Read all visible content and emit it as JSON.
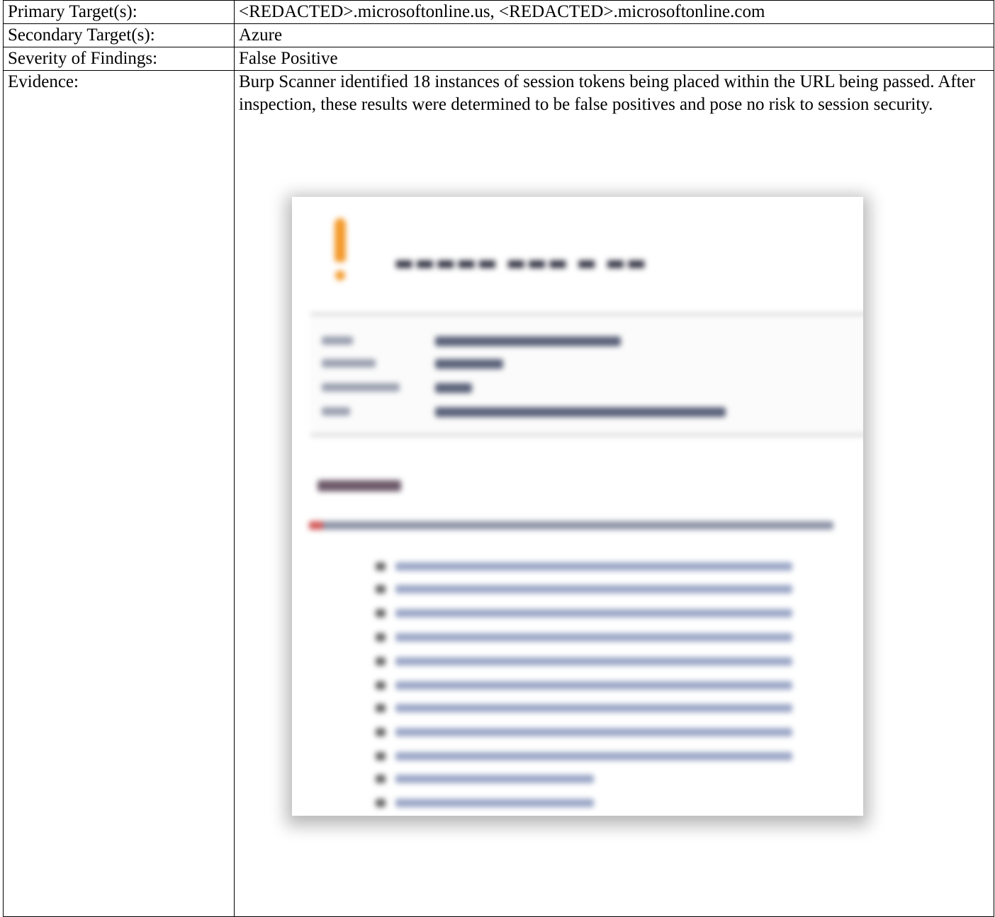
{
  "rows": [
    {
      "label": "Primary Target(s):",
      "value": "<REDACTED>.microsoftonline.us, <REDACTED>.microsoftonline.com"
    },
    {
      "label": "Secondary Target(s):",
      "value": "Azure"
    },
    {
      "label": "Severity of Findings:",
      "value": "False Positive"
    },
    {
      "label": "Evidence:",
      "value": "Burp Scanner identified 18 instances of session tokens being placed within the URL being passed. After inspection, these results were determined to be false positives and pose no risk to session security."
    }
  ],
  "colors": {
    "warning_accent": "#f39a2b",
    "border": "#000000"
  }
}
